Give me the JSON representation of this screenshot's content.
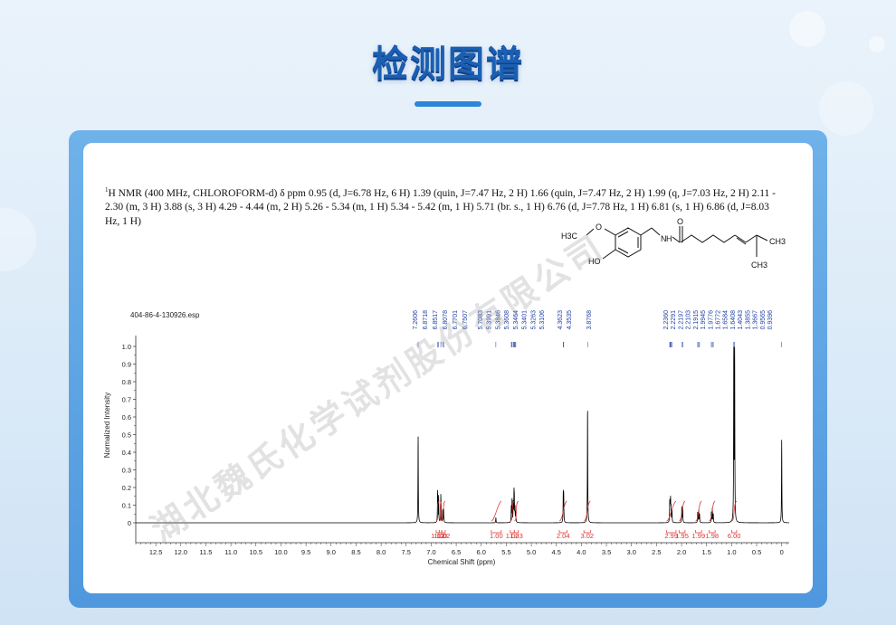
{
  "page": {
    "title": "检测图谱",
    "accent_color": "#1b5fb3",
    "watermark": "湖北魏氏化学试剂股份有限公司"
  },
  "nmr": {
    "nucleus_mark": "1",
    "description": "H NMR (400 MHz, CHLOROFORM-d) δ ppm 0.95 (d, J=6.78 Hz, 6 H) 1.39 (quin, J=7.47 Hz, 2 H) 1.66 (quin, J=7.47 Hz, 2 H) 1.99 (q, J=7.03 Hz, 2 H) 2.11 - 2.30 (m, 3 H) 3.88 (s, 3 H) 4.29 - 4.44 (m, 2 H) 5.26 - 5.34 (m, 1 H) 5.34 - 5.42 (m, 1 H) 5.71 (br. s., 1 H) 6.76 (d, J=7.78 Hz, 1 H) 6.81 (s, 1 H) 6.86 (d, J=8.03 Hz, 1 H)"
  },
  "structure": {
    "labels": [
      "H3C",
      "O",
      "HO",
      "N",
      "H",
      "O",
      "CH3",
      "CH3"
    ]
  },
  "chart_data": {
    "type": "line",
    "file_label": "404-86-4-130926.esp",
    "xlabel": "Chemical Shift (ppm)",
    "ylabel": "Normalized Intensity",
    "x_reversed": true,
    "xlim": [
      13.0,
      -0.15
    ],
    "ylim": [
      -0.05,
      1.05
    ],
    "x_ticks": [
      12.5,
      12.0,
      11.5,
      11.0,
      10.5,
      10.0,
      9.5,
      9.0,
      8.5,
      8.0,
      7.5,
      7.0,
      6.5,
      6.0,
      5.5,
      5.0,
      4.5,
      4.0,
      3.5,
      3.0,
      2.5,
      2.0,
      1.5,
      1.0,
      0.5,
      0
    ],
    "y_ticks": [
      0,
      0.1,
      0.2,
      0.3,
      0.4,
      0.5,
      0.6,
      0.7,
      0.8,
      0.9,
      1.0
    ],
    "peaks": [
      {
        "ppm": 7.2606,
        "h": 0.5
      },
      {
        "ppm": 6.8718,
        "h": 0.18
      },
      {
        "ppm": 6.8517,
        "h": 0.15
      },
      {
        "ppm": 6.8078,
        "h": 0.16
      },
      {
        "ppm": 6.7701,
        "h": 0.07
      },
      {
        "ppm": 6.7507,
        "h": 0.08
      },
      {
        "ppm": 5.7083,
        "h": 0.03
      },
      {
        "ppm": 5.3991,
        "h": 0.09
      },
      {
        "ppm": 5.3846,
        "h": 0.13
      },
      {
        "ppm": 5.3608,
        "h": 0.11
      },
      {
        "ppm": 5.3464,
        "h": 0.15
      },
      {
        "ppm": 5.3401,
        "h": 0.12
      },
      {
        "ppm": 5.3263,
        "h": 0.08
      },
      {
        "ppm": 5.3106,
        "h": 0.06
      },
      {
        "ppm": 4.3623,
        "h": 0.16
      },
      {
        "ppm": 4.3535,
        "h": 0.15
      },
      {
        "ppm": 3.8768,
        "h": 0.66
      },
      {
        "ppm": 2.236,
        "h": 0.1
      },
      {
        "ppm": 2.2291,
        "h": 0.09
      },
      {
        "ppm": 2.2197,
        "h": 0.12
      },
      {
        "ppm": 2.2103,
        "h": 0.08
      },
      {
        "ppm": 2.1915,
        "h": 0.07
      },
      {
        "ppm": 1.9945,
        "h": 0.09
      },
      {
        "ppm": 1.9776,
        "h": 0.08
      },
      {
        "ppm": 1.6772,
        "h": 0.06
      },
      {
        "ppm": 1.6584,
        "h": 0.07
      },
      {
        "ppm": 1.6408,
        "h": 0.05
      },
      {
        "ppm": 1.4043,
        "h": 0.06
      },
      {
        "ppm": 1.3855,
        "h": 0.08
      },
      {
        "ppm": 1.3667,
        "h": 0.05
      },
      {
        "ppm": 0.9565,
        "h": 1.0
      },
      {
        "ppm": 0.9396,
        "h": 0.95
      },
      {
        "ppm": 0.0,
        "h": 0.47
      }
    ],
    "peak_label_groups": [
      [
        "7.2606",
        "6.8718",
        "6.8517",
        "6.8078",
        "6.7701",
        "6.7507"
      ],
      [
        "5.7083",
        "5.3991",
        "5.3846",
        "5.3608",
        "5.3464",
        "5.3401",
        "5.3263",
        "5.3106"
      ],
      [
        "4.3623",
        "4.3535"
      ],
      [
        "3.8768"
      ],
      [
        "2.2360",
        "2.2291",
        "2.2197",
        "2.2103",
        "2.1915",
        "1.9945",
        "1.9776",
        "1.6772",
        "1.6584",
        "1.6408",
        "1.4043",
        "1.3855",
        "1.3667",
        "0.9565",
        "0.9396"
      ]
    ],
    "integrals": [
      {
        "value": "1.02",
        "from": 6.9,
        "to": 6.84
      },
      {
        "value": "1.00",
        "from": 6.84,
        "to": 6.79
      },
      {
        "value": "1.02",
        "from": 6.79,
        "to": 6.72
      },
      {
        "value": "1.00",
        "from": 5.8,
        "to": 5.6
      },
      {
        "value": "1.02",
        "from": 5.42,
        "to": 5.34
      },
      {
        "value": "1.03",
        "from": 5.34,
        "to": 5.26
      },
      {
        "value": "2.04",
        "from": 4.44,
        "to": 4.29
      },
      {
        "value": "3.02",
        "from": 3.95,
        "to": 3.82
      },
      {
        "value": "2.99",
        "from": 2.3,
        "to": 2.11
      },
      {
        "value": "1.95",
        "from": 2.05,
        "to": 1.93
      },
      {
        "value": "1.99",
        "from": 1.72,
        "to": 1.6
      },
      {
        "value": "1.98",
        "from": 1.45,
        "to": 1.33
      },
      {
        "value": "6.00",
        "from": 1.0,
        "to": 0.9
      }
    ]
  }
}
